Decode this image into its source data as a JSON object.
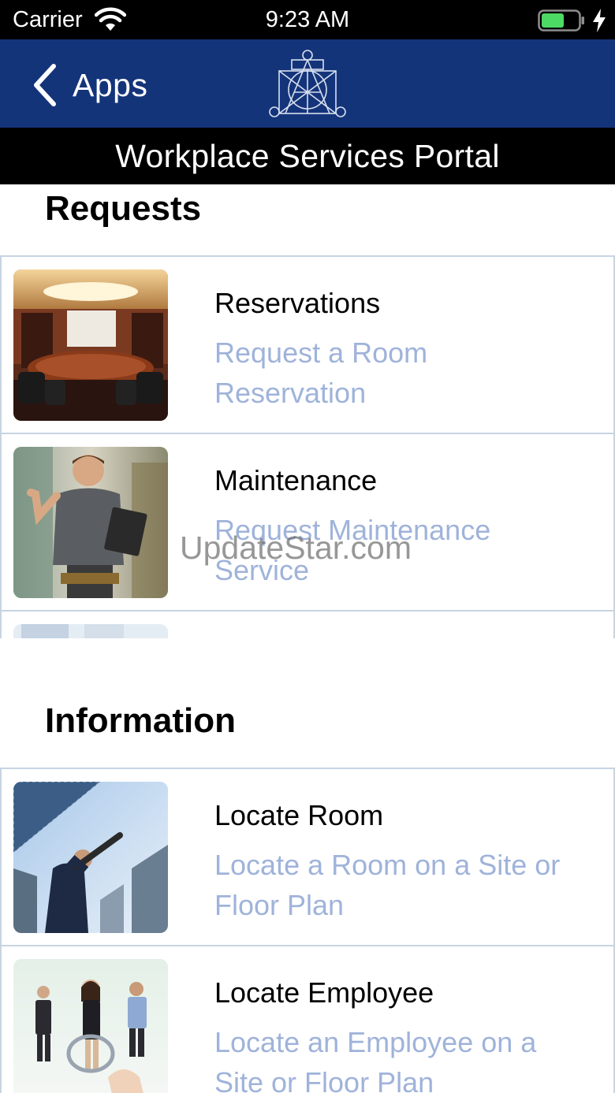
{
  "status_bar": {
    "carrier": "Carrier",
    "time": "9:23 AM"
  },
  "nav": {
    "back_label": "Apps",
    "background_color": "#14347a"
  },
  "title_bar": {
    "title": "Workplace Services Portal"
  },
  "sections": [
    {
      "heading": "Requests",
      "cards": [
        {
          "title": "Reservations",
          "subtitle": "Request a Room Reservation",
          "image": "conference-room-photo"
        },
        {
          "title": "Maintenance",
          "subtitle": "Request Maintenance Service",
          "image": "maintenance-worker-photo"
        },
        {
          "image": "partially-visible-photo"
        }
      ]
    },
    {
      "heading": "Information",
      "cards": [
        {
          "title": "Locate Room",
          "subtitle": "Locate a Room on a Site or Floor Plan",
          "image": "city-buildings-photo"
        },
        {
          "title": "Locate Employee",
          "subtitle": "Locate an Employee on a Site or Floor Plan",
          "image": "employees-photo"
        }
      ]
    }
  ],
  "watermark": "UpdateStar.com",
  "colors": {
    "subtitle": "#9fb3da",
    "card_border": "#c7d4e2",
    "battery": "#4cd964"
  }
}
